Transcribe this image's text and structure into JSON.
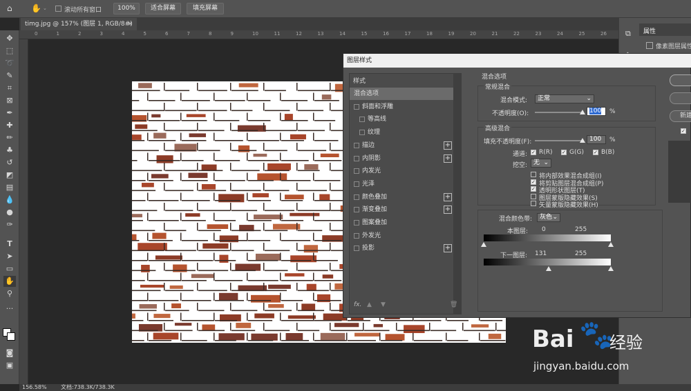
{
  "options_bar": {
    "scroll_all_label": "滚动所有窗口",
    "zoom_value": "100%",
    "fit_screen_label": "适合屏幕",
    "fill_screen_label": "填充屏幕"
  },
  "document_tab": {
    "title": "timg.jpg @ 157% (图层 1, RGB/8#) *",
    "close": "×"
  },
  "ruler_ticks": [
    "0",
    "1",
    "2",
    "3",
    "4",
    "5",
    "6",
    "7",
    "8",
    "9",
    "10",
    "11",
    "12",
    "13",
    "14",
    "15",
    "16",
    "17",
    "18",
    "19",
    "20",
    "21",
    "22",
    "23",
    "24",
    "25",
    "26",
    "27"
  ],
  "properties_panel": {
    "title": "属性",
    "pixel_layer_props": "像素图层属性",
    "new_label": "新建"
  },
  "status_bar": {
    "zoom": "156.58%",
    "doc_info": "文档:738.3K/738.3K"
  },
  "dialog": {
    "title": "图层样式",
    "styles_header": "样式",
    "style_items": [
      {
        "label": "混合选项",
        "checkbox": false,
        "plus": false,
        "selected": true,
        "indent": false
      },
      {
        "label": "斜面和浮雕",
        "checkbox": true,
        "plus": false,
        "selected": false,
        "indent": false
      },
      {
        "label": "等高线",
        "checkbox": true,
        "plus": false,
        "selected": false,
        "indent": true
      },
      {
        "label": "纹理",
        "checkbox": true,
        "plus": false,
        "selected": false,
        "indent": true
      },
      {
        "label": "描边",
        "checkbox": true,
        "plus": true,
        "selected": false,
        "indent": false
      },
      {
        "label": "内阴影",
        "checkbox": true,
        "plus": true,
        "selected": false,
        "indent": false
      },
      {
        "label": "内发光",
        "checkbox": true,
        "plus": false,
        "selected": false,
        "indent": false
      },
      {
        "label": "光泽",
        "checkbox": true,
        "plus": false,
        "selected": false,
        "indent": false
      },
      {
        "label": "颜色叠加",
        "checkbox": true,
        "plus": true,
        "selected": false,
        "indent": false
      },
      {
        "label": "渐变叠加",
        "checkbox": true,
        "plus": true,
        "selected": false,
        "indent": false
      },
      {
        "label": "图案叠加",
        "checkbox": true,
        "plus": false,
        "selected": false,
        "indent": false
      },
      {
        "label": "外发光",
        "checkbox": true,
        "plus": false,
        "selected": false,
        "indent": false
      },
      {
        "label": "投影",
        "checkbox": true,
        "plus": true,
        "selected": false,
        "indent": false
      }
    ],
    "fx_label": "fx.",
    "blend_options_title": "混合选项",
    "general_blend": {
      "title": "常规混合",
      "mode_label": "混合模式:",
      "mode_value": "正常",
      "opacity_label": "不透明度(O):",
      "opacity_value": "100",
      "opacity_unit": "%"
    },
    "advanced_blend": {
      "title": "高级混合",
      "fill_opacity_label": "填充不透明度(F):",
      "fill_opacity_value": "100",
      "fill_opacity_unit": "%",
      "channels_label": "通道:",
      "channel_r": "R(R)",
      "channel_g": "G(G)",
      "channel_b": "B(B)",
      "knockout_label": "挖空:",
      "knockout_value": "无",
      "options": [
        {
          "label": "将内部效果混合成组(I)",
          "checked": false
        },
        {
          "label": "将剪贴图层混合成组(P)",
          "checked": true
        },
        {
          "label": "透明形状图层(T)",
          "checked": true
        },
        {
          "label": "图层蒙版隐藏效果(S)",
          "checked": false
        },
        {
          "label": "矢量蒙版隐藏效果(H)",
          "checked": false
        }
      ]
    },
    "blend_if": {
      "label": "混合颜色带:",
      "value": "灰色",
      "this_layer_label": "本图层:",
      "this_layer_min": "0",
      "this_layer_max": "255",
      "under_layer_label": "下一图层:",
      "under_layer_min": "131",
      "under_layer_max": "255"
    }
  },
  "watermark": {
    "brand": "Bai",
    "brand2": "经验",
    "url": "jingyan.baidu.com"
  }
}
